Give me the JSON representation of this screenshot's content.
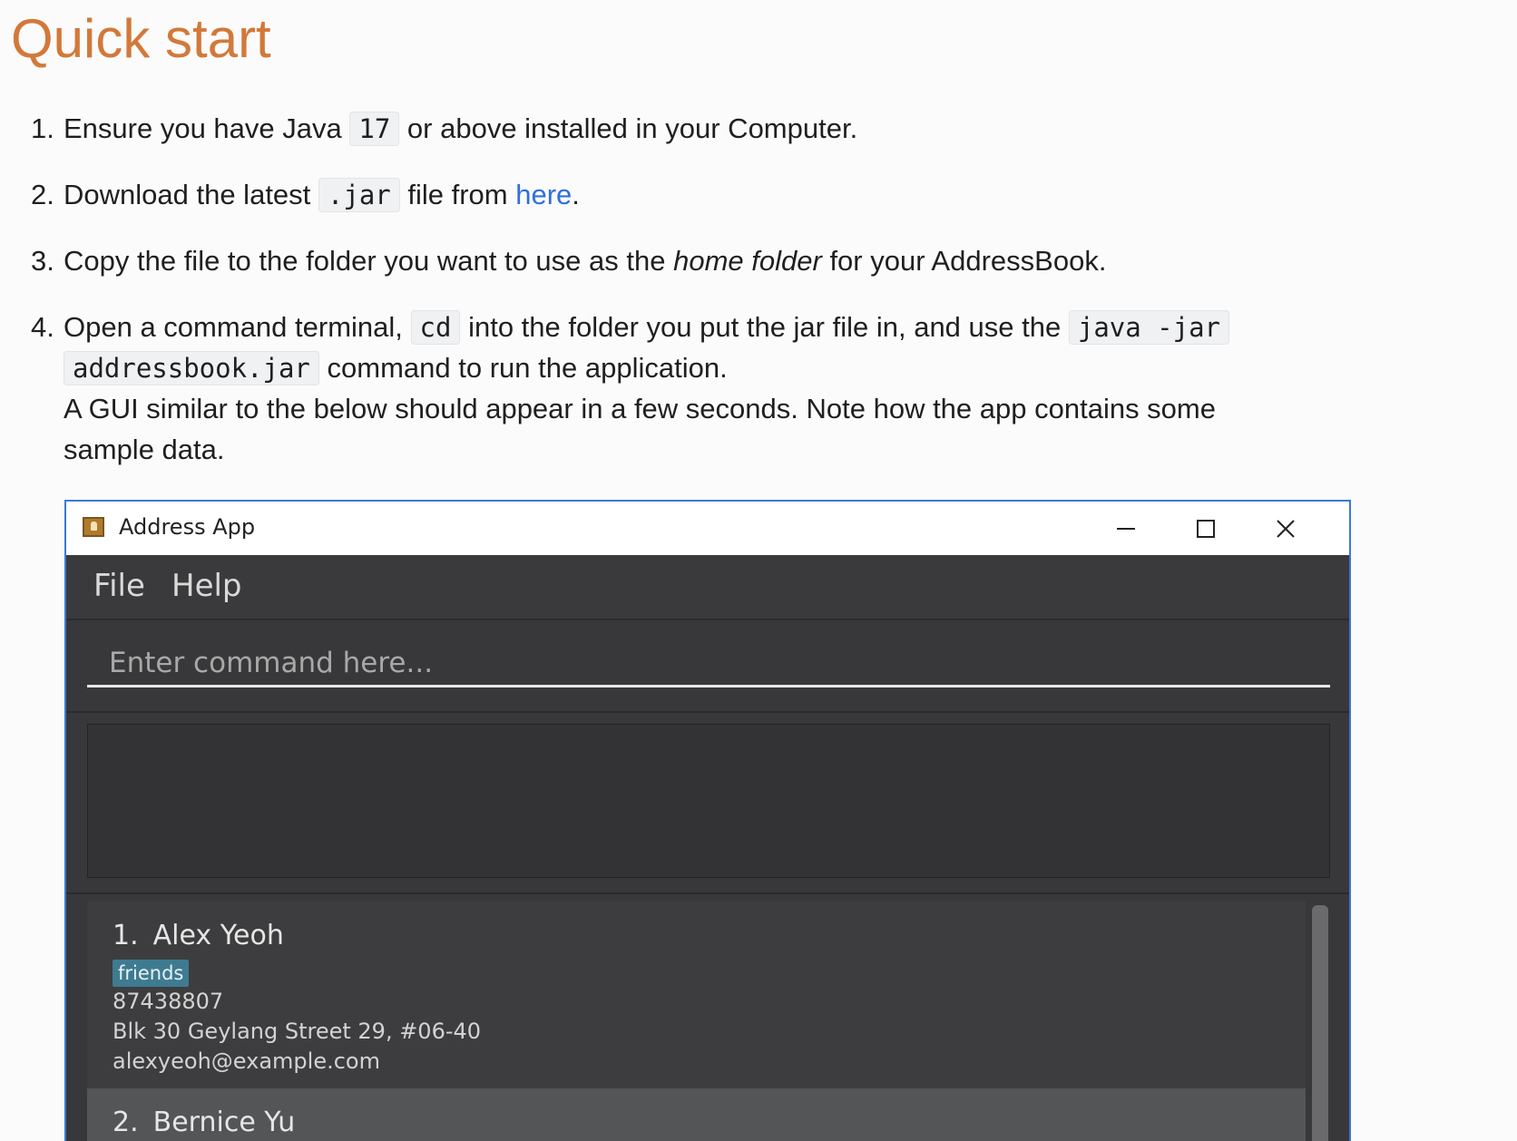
{
  "page": {
    "heading": "Quick start",
    "steps": [
      {
        "num": "1.",
        "before": "Ensure you have Java",
        "code": "17",
        "after": "or above installed in your Computer."
      },
      {
        "num": "2.",
        "before": "Download the latest",
        "code": ".jar",
        "middle": "file from",
        "link": "here",
        "after": "."
      },
      {
        "num": "3.",
        "before": "Copy the file to the folder you want to use as the",
        "emphasis": "home folder",
        "after": "for your AddressBook."
      },
      {
        "num": "4.",
        "before": "Open a command terminal,",
        "code1": "cd",
        "middle": "into the folder you put the jar file in, and use the",
        "code2a": "java -jar",
        "code2b": "addressbook.jar",
        "after": "command to run the application.",
        "note_line1": "A GUI similar to the below should appear in a few seconds. Note how the app contains some",
        "note_line2": "sample data."
      }
    ]
  },
  "app": {
    "window_title": "Address App",
    "menu": [
      "File",
      "Help"
    ],
    "command_placeholder": "Enter command here...",
    "persons": [
      {
        "index": "1.",
        "name": "Alex Yeoh",
        "tag": "friends",
        "phone": "87438807",
        "address": "Blk 30 Geylang Street 29, #06-40",
        "email": "alexyeoh@example.com"
      },
      {
        "index": "2.",
        "name": "Bernice Yu"
      }
    ]
  },
  "colors": {
    "heading": "#d2793a",
    "link": "#2f6fe0",
    "window_border": "#3a78d8",
    "tag": "#3e7b91",
    "app_background": "#3b3b3d"
  },
  "icons": [
    "app-icon",
    "minimize-icon",
    "maximize-icon",
    "close-icon"
  ]
}
